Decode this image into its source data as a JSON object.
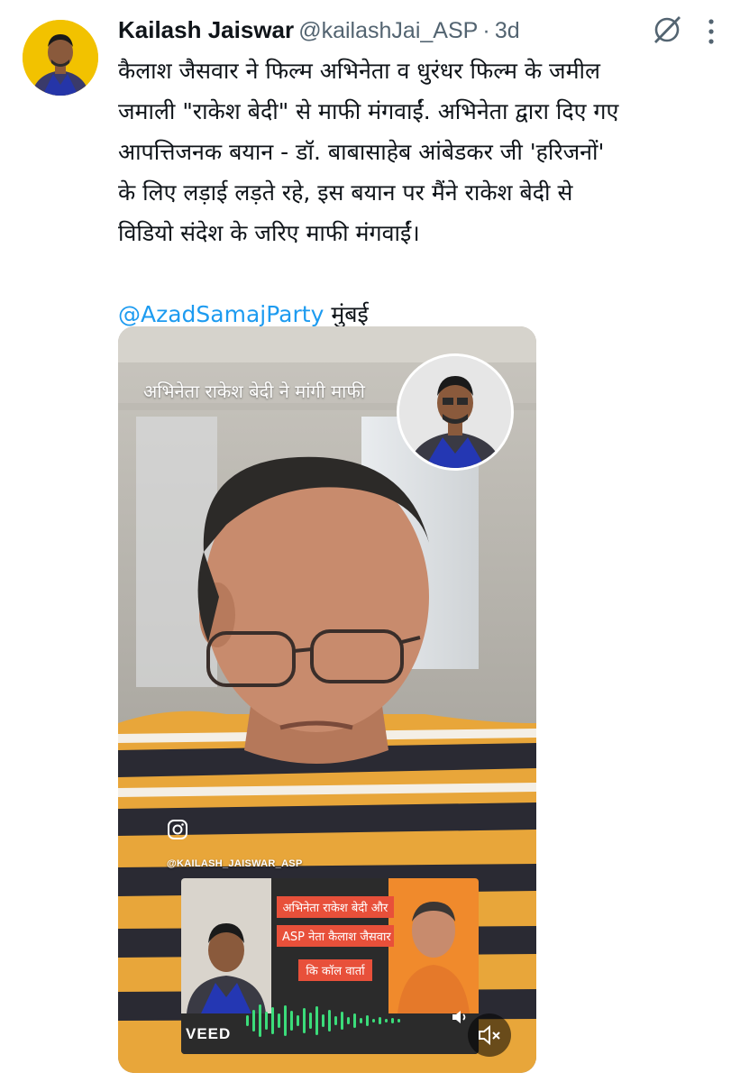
{
  "tweet": {
    "author_name": "Kailash Jaiswar",
    "author_handle": "@kailashJai_ASP",
    "separator": "·",
    "time": "3d",
    "body_lines": [
      "कैलाश जैसवार ने फिल्म अभिनेता व धुरंधर फिल्म के जमील",
      "जमाली \"राकेश बेदी\" से माफी मंगवाईं. अभिनेता द्वारा दिए गए",
      "आपत्तिजनक बयान - डॉ. बाबासाहेब आंबेडकर जी 'हरिजनों'",
      "के लिए लड़ाई लड़ते रहे, इस बयान पर मैंने राकेश बेदी से",
      "विडियो संदेश के जरिए माफी मंगवाईं।"
    ],
    "mention": "@AzadSamajParty",
    "location": "मुंबई"
  },
  "video": {
    "overlay_title": "अभिनेता राकेश बेदी ने मांगी माफी",
    "instagram_handle": "@KAILASH_JAISWAR_ASP",
    "card_lines": [
      "अभिनेता राकेश बेदी और",
      "ASP नेता कैलाश जैसवार",
      "कि कॉल वार्ता"
    ],
    "watermark": "VEED"
  },
  "icons": {
    "grok": "grok-icon",
    "more": "more-vertical-icon",
    "instagram": "instagram-icon",
    "volume": "volume-icon",
    "mute": "mute-icon"
  },
  "colors": {
    "text": "#0f1419",
    "secondary": "#536471",
    "link": "#1d9bf0",
    "card_label": "#e8503a"
  }
}
